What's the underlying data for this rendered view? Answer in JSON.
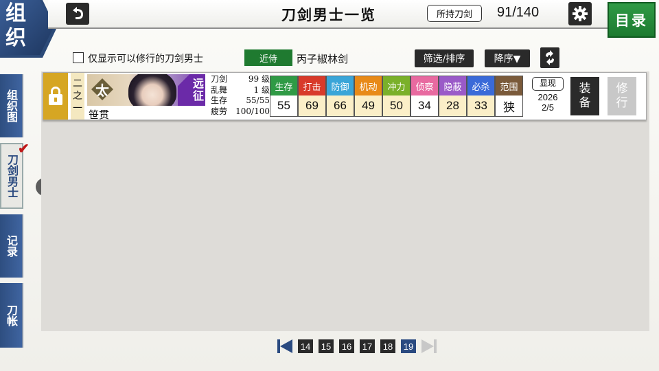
{
  "corner": {
    "line1": "组",
    "line2": "织"
  },
  "header": {
    "back_icon": "back-arrow-icon",
    "title": "刀剑男士一览",
    "owned_label": "所持刀剑",
    "owned_count": "91/140",
    "settings_icon": "gear-icon",
    "menu_label": "目录"
  },
  "filter": {
    "checkbox_label": "仅显示可以修行的刀剑男士",
    "team_label": "近侍",
    "sword_name": "丙子椒林剑",
    "filter_label": "筛选/排序",
    "sort_label": "降序▼",
    "swap_icon": "swap-icon"
  },
  "nav": [
    {
      "label": "组织图"
    },
    {
      "label": "刀剑男士"
    },
    {
      "label": "记录"
    },
    {
      "label": "刀帐"
    }
  ],
  "row": {
    "rank": [
      "二",
      "之",
      "一"
    ],
    "type": "太",
    "expedition": [
      "远",
      "征"
    ],
    "name": "笹贯",
    "info": [
      {
        "label": "刀剑",
        "value": "99 级"
      },
      {
        "label": "乱舞",
        "value": "1 级"
      },
      {
        "label": "生存",
        "value": "55/55"
      },
      {
        "label": "疲劳",
        "value": "100/100"
      }
    ],
    "stats": [
      {
        "label": "生存",
        "value": "55",
        "head": "#2f9a45",
        "bg": "#ffffff"
      },
      {
        "label": "打击",
        "value": "69",
        "head": "#d83a2a",
        "bg": "#fbefc8"
      },
      {
        "label": "防御",
        "value": "66",
        "head": "#3aa5d8",
        "bg": "#fbefc8"
      },
      {
        "label": "机动",
        "value": "49",
        "head": "#e88a18",
        "bg": "#fbefc8"
      },
      {
        "label": "冲力",
        "value": "50",
        "head": "#7ab02a",
        "bg": "#fbefc8"
      },
      {
        "label": "侦察",
        "value": "34",
        "head": "#e86aa0",
        "bg": "#ffffff"
      },
      {
        "label": "隐蔽",
        "value": "28",
        "head": "#9a5ac8",
        "bg": "#fbefc8"
      },
      {
        "label": "必杀",
        "value": "33",
        "head": "#3a6ad8",
        "bg": "#fbefc8"
      },
      {
        "label": "范围",
        "value": "狭",
        "head": "#7a5a3a",
        "bg": "#ffffff"
      }
    ],
    "display_label": "显现",
    "date_year": "2026",
    "date_day": "2/5",
    "equip_label": [
      "装",
      "备"
    ],
    "train_label": [
      "修",
      "行"
    ]
  },
  "pager": {
    "pages": [
      "14",
      "15",
      "16",
      "17",
      "18",
      "19"
    ],
    "current": "19"
  }
}
